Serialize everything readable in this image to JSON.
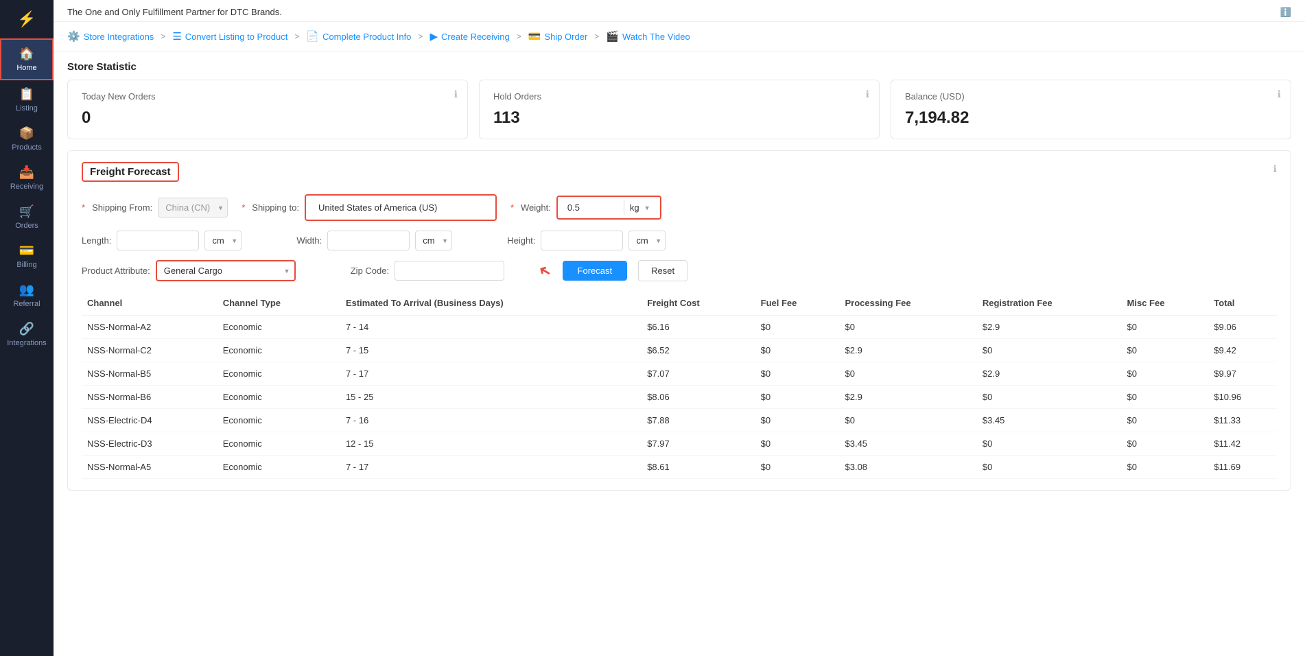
{
  "sidebar": {
    "logo": "⚡",
    "items": [
      {
        "id": "home",
        "label": "Home",
        "icon": "🏠",
        "active": true
      },
      {
        "id": "listing",
        "label": "Listing",
        "icon": "📋"
      },
      {
        "id": "products",
        "label": "Products",
        "icon": "📦"
      },
      {
        "id": "receiving",
        "label": "Receiving",
        "icon": "📥"
      },
      {
        "id": "orders",
        "label": "Orders",
        "icon": "🛒"
      },
      {
        "id": "billing",
        "label": "Billing",
        "icon": "💳"
      },
      {
        "id": "referral",
        "label": "Referral",
        "icon": "👥"
      },
      {
        "id": "integrations",
        "label": "Integrations",
        "icon": "🔗"
      }
    ]
  },
  "top_banner": {
    "text": "The One and Only Fulfillment Partner for DTC Brands."
  },
  "steps": [
    {
      "id": "store-integrations",
      "label": "Store Integrations",
      "icon": "⚙️"
    },
    {
      "id": "convert-listing",
      "label": "Convert Listing to Product",
      "icon": "☰"
    },
    {
      "id": "complete-product-info",
      "label": "Complete Product Info",
      "icon": "📄"
    },
    {
      "id": "create-receiving",
      "label": "Create Receiving",
      "icon": "▶"
    },
    {
      "id": "ship-order",
      "label": "Ship Order",
      "icon": "💳"
    },
    {
      "id": "watch-video",
      "label": "Watch The Video",
      "icon": "🎬"
    }
  ],
  "store_statistic": {
    "title": "Store Statistic",
    "cards": [
      {
        "label": "Today New Orders",
        "value": "0"
      },
      {
        "label": "Hold Orders",
        "value": "113"
      },
      {
        "label": "Balance (USD)",
        "value": "7,194.82"
      }
    ]
  },
  "freight_forecast": {
    "title": "Freight Forecast",
    "shipping_from_label": "Shipping From:",
    "shipping_from_value": "China (CN)",
    "shipping_to_label": "Shipping to:",
    "shipping_to_value": "United States of America  (US)",
    "weight_label": "Weight:",
    "weight_value": "0.5",
    "weight_unit": "kg",
    "length_label": "Length:",
    "length_unit": "cm",
    "width_label": "Width:",
    "width_unit": "cm",
    "height_label": "Height:",
    "height_unit": "cm",
    "zip_code_label": "Zip Code:",
    "product_attr_label": "Product Attribute:",
    "product_attr_value": "General Cargo",
    "forecast_btn": "Forecast",
    "reset_btn": "Reset"
  },
  "table": {
    "headers": [
      "Channel",
      "Channel Type",
      "Estimated To Arrival (Business Days)",
      "Freight Cost",
      "Fuel Fee",
      "Processing Fee",
      "Registration Fee",
      "Misc Fee",
      "Total"
    ],
    "rows": [
      {
        "channel": "NSS-Normal-A2",
        "type": "Economic",
        "eta": "7 - 14",
        "freight": "$6.16",
        "fuel": "$0",
        "processing": "$0",
        "registration": "$2.9",
        "misc": "$0",
        "total": "$9.06"
      },
      {
        "channel": "NSS-Normal-C2",
        "type": "Economic",
        "eta": "7 - 15",
        "freight": "$6.52",
        "fuel": "$0",
        "processing": "$2.9",
        "registration": "$0",
        "misc": "$0",
        "total": "$9.42"
      },
      {
        "channel": "NSS-Normal-B5",
        "type": "Economic",
        "eta": "7 - 17",
        "freight": "$7.07",
        "fuel": "$0",
        "processing": "$0",
        "registration": "$2.9",
        "misc": "$0",
        "total": "$9.97"
      },
      {
        "channel": "NSS-Normal-B6",
        "type": "Economic",
        "eta": "15 - 25",
        "freight": "$8.06",
        "fuel": "$0",
        "processing": "$2.9",
        "registration": "$0",
        "misc": "$0",
        "total": "$10.96"
      },
      {
        "channel": "NSS-Electric-D4",
        "type": "Economic",
        "eta": "7 - 16",
        "freight": "$7.88",
        "fuel": "$0",
        "processing": "$0",
        "registration": "$3.45",
        "misc": "$0",
        "total": "$11.33"
      },
      {
        "channel": "NSS-Electric-D3",
        "type": "Economic",
        "eta": "12 - 15",
        "freight": "$7.97",
        "fuel": "$0",
        "processing": "$3.45",
        "registration": "$0",
        "misc": "$0",
        "total": "$11.42"
      },
      {
        "channel": "NSS-Normal-A5",
        "type": "Economic",
        "eta": "7 - 17",
        "freight": "$8.61",
        "fuel": "$0",
        "processing": "$3.08",
        "registration": "$0",
        "misc": "$0",
        "total": "$11.69"
      }
    ]
  }
}
